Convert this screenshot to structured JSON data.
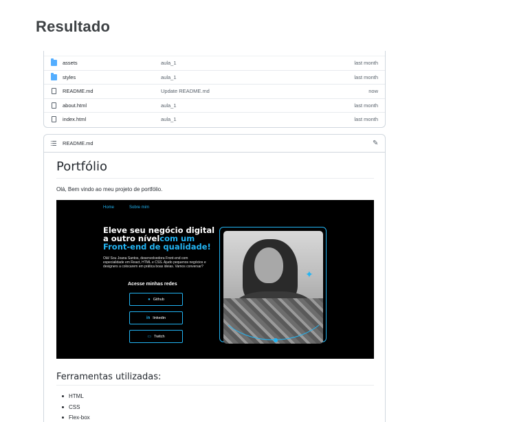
{
  "page": {
    "heading": "Resultado"
  },
  "files": [
    {
      "name": "assets",
      "type": "folder",
      "commit": "aula_1",
      "date": "last month"
    },
    {
      "name": "styles",
      "type": "folder",
      "commit": "aula_1",
      "date": "last month"
    },
    {
      "name": "README.md",
      "type": "file",
      "commit": "Update README.md",
      "date": "now"
    },
    {
      "name": "about.html",
      "type": "file",
      "commit": "aula_1",
      "date": "last month"
    },
    {
      "name": "index.html",
      "type": "file",
      "commit": "aula_1",
      "date": "last month"
    }
  ],
  "readme": {
    "filename": "README.md",
    "title": "Portfólio",
    "intro": "Olá, Bem vindo ao meu projeto de portfólio.",
    "preview": {
      "nav": [
        "Home",
        "Sobre mim"
      ],
      "hero_title_plain": "Eleve seu negócio digital a outro nível",
      "hero_title_accent": "com um Front-end de qualidade!",
      "hero_text": "Olá! Sou Joana Santos, desenvolvedora Front-end com especialidade em React, HTML e CSS. Ajudo pequenos negócios e designers a colocarem em prática boas ideias. Vamos conversar?",
      "social_heading": "Acesse minhas redes",
      "social_buttons": [
        {
          "label": "Github",
          "icon": "github-icon"
        },
        {
          "label": "linkedin",
          "icon": "linkedin-icon"
        },
        {
          "label": "Twitch",
          "icon": "twitch-icon"
        }
      ]
    },
    "tools_heading": "Ferramentas utilizadas:",
    "tools": [
      "HTML",
      "CSS",
      "Flex-box"
    ]
  },
  "colors": {
    "accent": "#22b5f4",
    "folder": "#54aeff",
    "text": "#24292f",
    "muted": "#57606a"
  }
}
